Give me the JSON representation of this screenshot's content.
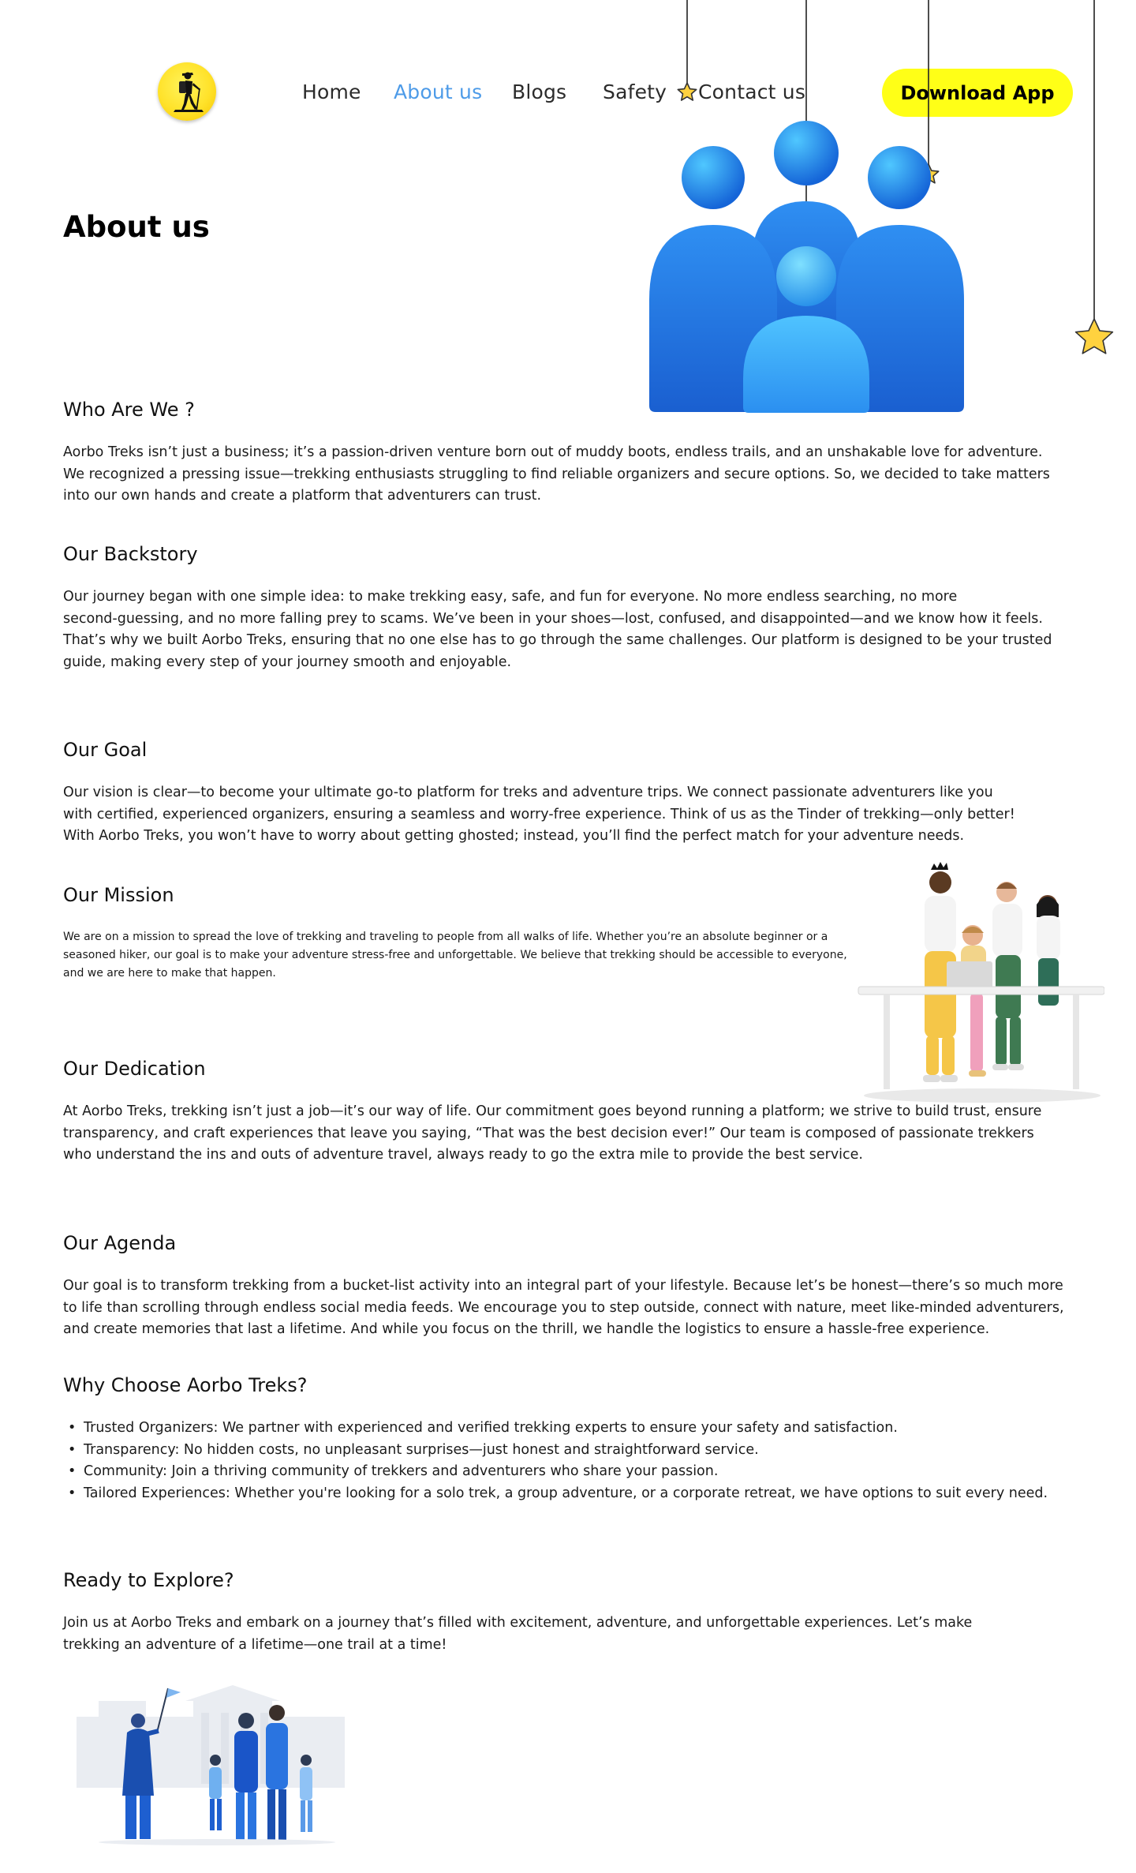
{
  "header": {
    "logo_icon": "hiker-logo-icon",
    "nav": [
      {
        "label": "Home",
        "active": false
      },
      {
        "label": "About us",
        "active": true
      },
      {
        "label": "Blogs",
        "active": false
      },
      {
        "label": "Safety",
        "active": false
      },
      {
        "label": "Contact us",
        "active": false
      }
    ],
    "download_label": "Download App"
  },
  "colors": {
    "accent_yellow": "#ffff17",
    "active_link": "#4d9be8",
    "star": "#ffd23f",
    "hero_blue": "#2a7be8"
  },
  "page": {
    "title": "About us"
  },
  "sections": {
    "who": {
      "heading": "Who Are We ?",
      "lines": [
        "Aorbo Treks isn’t just a business; it’s a passion-driven venture born out of  muddy boots, endless trails, and an unshakable love for adventure.",
        "We  recognized a pressing issue—trekking enthusiasts struggling to find  reliable organizers and secure options. So, we decided to take matters",
        " into our own hands and create a platform that adventurers can trust."
      ]
    },
    "backstory": {
      "heading": "Our Backstory",
      "lines": [
        "Our journey began with one simple idea: to make trekking easy, safe, and  fun for everyone. No more endless searching, no more",
        "second-guessing,  and no more falling prey to scams. We’ve been in your shoes—lost,  confused, and disappointed—and we know how it feels.",
        "That’s why we built Aorbo Treks, ensuring that no one else has to go through the same  challenges. Our platform is designed to be your trusted",
        "guide, making  every step of your journey smooth and enjoyable."
      ]
    },
    "goal": {
      "heading": "Our Goal",
      "lines": [
        "Our vision is clear—to become your ultimate go-to platform for treks and  adventure trips. We connect passionate adventurers like you",
        "with  certified, experienced organizers, ensuring a seamless and worry-free  experience. Think of us as the Tinder of trekking—only better!",
        "With  Aorbo Treks, you won’t have to worry about getting ghosted; instead,  you’ll find the perfect match for your adventure needs."
      ]
    },
    "mission": {
      "heading": "Our Mission",
      "lines": [
        "We are on a mission to spread the love of trekking and traveling to people from all walks of life. Whether you’re an absolute beginner or a",
        "seasoned hiker, our goal is to make your adventure stress-free and  unforgettable. We believe that trekking should be accessible to  everyone,",
        "and we are here to make that happen."
      ]
    },
    "dedication": {
      "heading": "Our Dedication",
      "lines": [
        "At Aorbo Treks, trekking isn’t just a job—it’s our way of life. Our  commitment goes beyond running a platform; we strive to build trust,  ensure",
        "transparency, and craft experiences that leave you saying, “That  was the best decision ever!” Our team is composed of passionate trekkers",
        "who understand the ins and outs of adventure travel, always ready to go the extra mile to provide the best service."
      ]
    },
    "agenda": {
      "heading": "Our Agenda",
      "lines": [
        "Our goal is to transform trekking from a bucket-list activity into an  integral part of your lifestyle. Because let’s be honest—there’s so much more",
        "to life than scrolling through endless social media feeds. We  encourage you to step outside, connect with nature, meet like-minded adventurers,",
        "and create memories that last a lifetime. And while you  focus on the thrill, we handle the logistics to ensure a hassle-free  experience."
      ]
    },
    "why": {
      "heading": "Why Choose Aorbo Treks?",
      "items": [
        "Trusted Organizers: We partner with experienced and verified trekking experts to ensure your safety and satisfaction.",
        "Transparency: No hidden costs, no unpleasant surprises—just honest and straightforward service.",
        "Community: Join a thriving community of trekkers and adventurers who share your passion.",
        "Tailored Experiences: Whether you're looking for a solo trek, a group adventure, or a corporate retreat, we have options to suit every need."
      ]
    },
    "explore": {
      "heading": "Ready to Explore?",
      "lines": [
        "Join us at Aorbo Treks and embark on a journey that’s filled with  excitement, adventure, and unforgettable experiences. Let’s make",
        "trekking an adventure of a lifetime—one trail at a time!"
      ]
    }
  },
  "illustrations": {
    "hero": "group-people-icon",
    "team": "team-at-desk-illustration",
    "group": "hikers-group-illustration"
  }
}
